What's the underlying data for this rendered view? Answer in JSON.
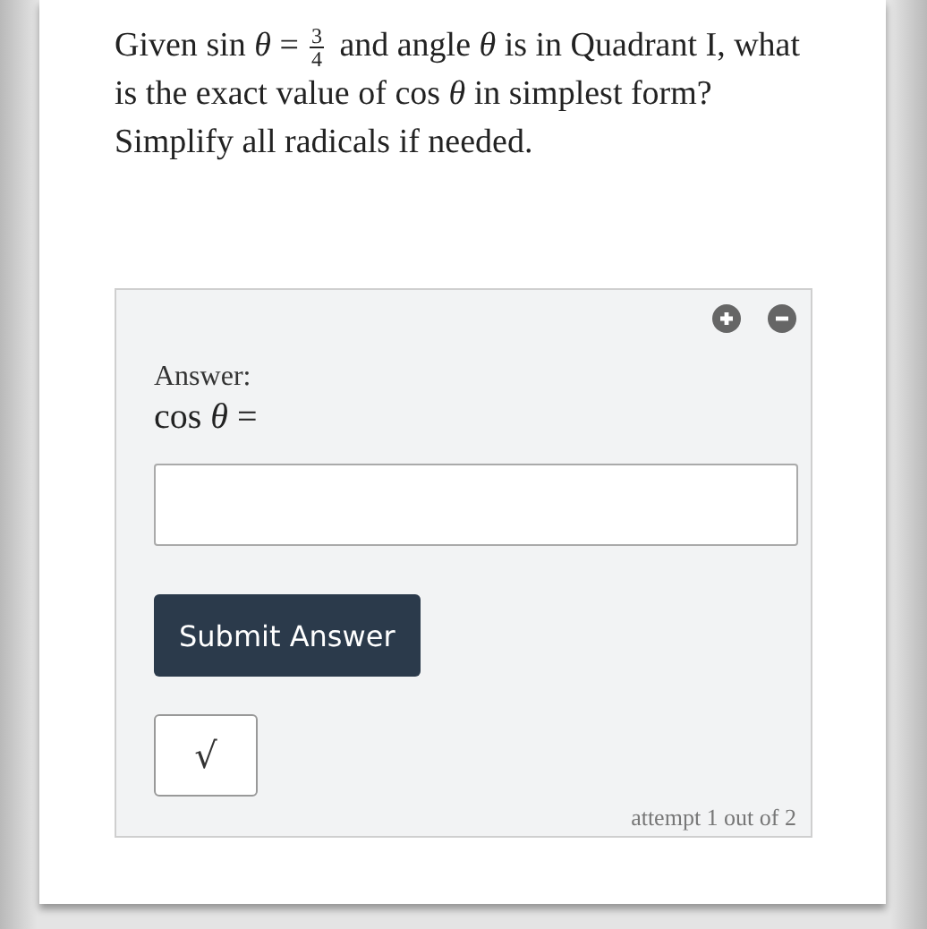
{
  "question": [
    {
      "kind": "text",
      "text": "Given "
    },
    {
      "kind": "math",
      "text": "sin *θ* ="
    },
    {
      "kind": "frac",
      "numerator": "3",
      "denominator": "4"
    },
    {
      "kind": "text",
      "text": " and angle "
    },
    {
      "kind": "math",
      "text": "*θ*"
    },
    {
      "kind": "text",
      "text": " is in Quadrant I, what is the exact value of "
    },
    {
      "kind": "math",
      "text": "cos *θ*"
    },
    {
      "kind": "text",
      "text": " in simplest form? Simplify all radicals if needed."
    }
  ],
  "answer_panel": {
    "label": "Answer:",
    "prompt": "cos *θ* =",
    "submit": "Submit Answer",
    "math_key": "√",
    "attempt": "attempt 1 out of 2"
  }
}
